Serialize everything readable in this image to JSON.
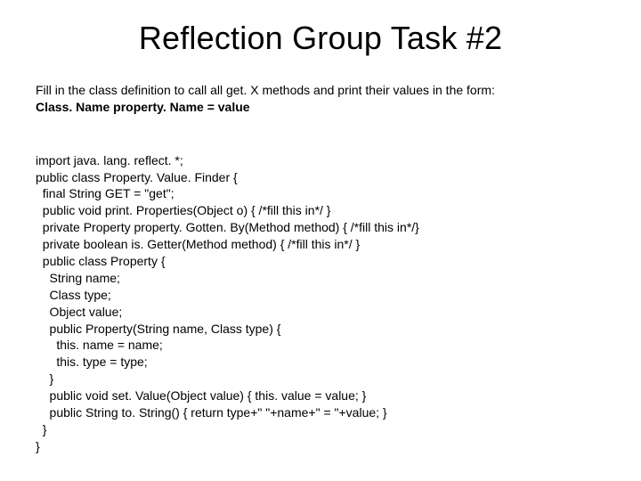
{
  "title": "Reflection Group Task #2",
  "prompt": {
    "line1": "Fill in the class definition to call all get. X methods and print their values in the form:",
    "line2": "Class. Name property. Name = value"
  },
  "code": {
    "l00": "import java. lang. reflect. *;",
    "l01": "public class Property. Value. Finder {",
    "l02": "  final String GET = \"get\";",
    "l03": "  public void print. Properties(Object o) { /*fill this in*/ }",
    "l04": "  private Property property. Gotten. By(Method method) { /*fill this in*/}",
    "l05": "  private boolean is. Getter(Method method) { /*fill this in*/ }",
    "l06": "  public class Property {",
    "l07": "    String name;",
    "l08": "    Class type;",
    "l09": "    Object value;",
    "l10": "    public Property(String name, Class type) {",
    "l11": "      this. name = name;",
    "l12": "      this. type = type;",
    "l13": "    }",
    "l14": "    public void set. Value(Object value) { this. value = value; }",
    "l15": "    public String to. String() { return type+\" \"+name+\" = \"+value; }",
    "l16": "  }",
    "l17": "}"
  }
}
